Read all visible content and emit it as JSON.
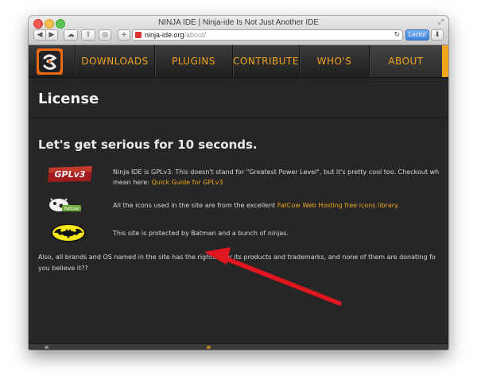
{
  "window": {
    "title": "NINJA IDE | Ninja-ide Is Not Just Another IDE"
  },
  "toolbar": {
    "url_host": "ninja-ide.org",
    "url_path": "/about/",
    "reader_label": "Lector"
  },
  "nav": {
    "items": [
      {
        "label": "DOWNLOADS"
      },
      {
        "label": "PLUGINS"
      },
      {
        "label": "CONTRIBUTE"
      },
      {
        "label": "WHO'S USING?"
      },
      {
        "label": "ABOUT"
      }
    ]
  },
  "content": {
    "heading": "License",
    "subheading": "Let's get serious for 10 seconds.",
    "license_row": {
      "icon_label": "GPLv3",
      "text": "Ninja IDE is GPLv3. This doesn't stand for \"Greatest Power Level\", but it's pretty cool too. Checkout wh",
      "text2": "mean here: ",
      "link": "Quick Guide for GPLv3"
    },
    "icons_row": {
      "icon_label": "FatCow",
      "text": "All the icons used in the site are from the excellent ",
      "link": "FatCow Web Hosting free icons library."
    },
    "batman_row": {
      "text": "This site is protected by Batman and a bunch of ninjas."
    },
    "paragraph": {
      "line1": "Also, all brands and OS named in the site has the rights over its products and trademarks, and none of them are donating fo",
      "line2": "you believe it??"
    }
  },
  "colors": {
    "accent": "#f0a51e",
    "page_bg": "#262626",
    "annotation_arrow": "#e0171f"
  }
}
